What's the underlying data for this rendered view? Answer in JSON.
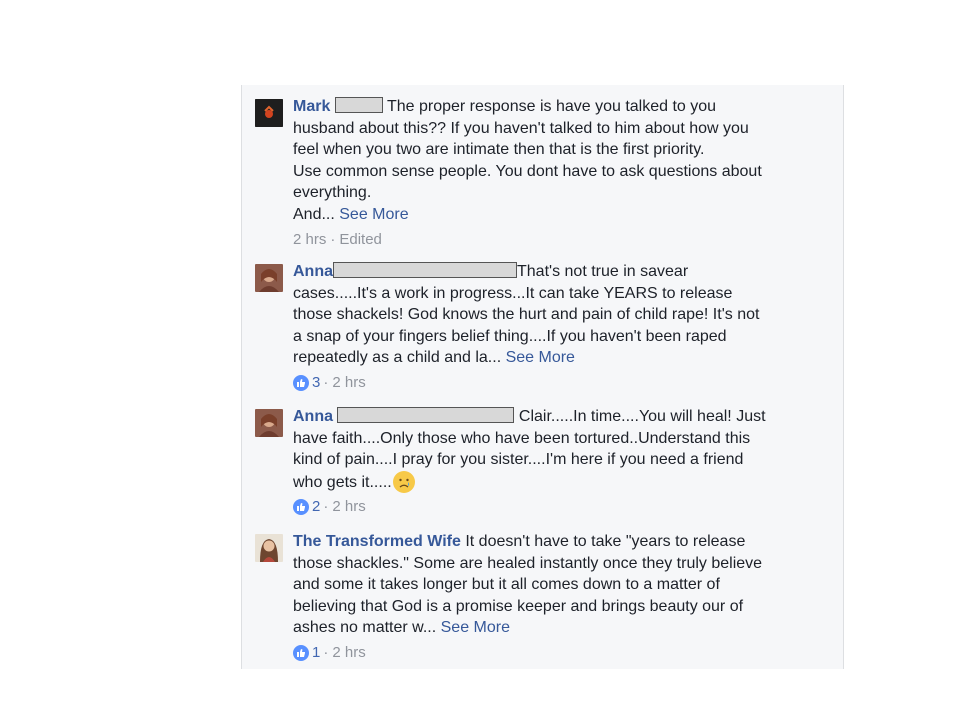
{
  "comments": [
    {
      "name": "Mark",
      "text_lines": [
        "The proper response is have you talked to you",
        "husband about this?? If you haven't talked to him about how you",
        "feel when you two are intimate then that is the first priority.",
        "Use common sense people. You dont have to ask questions about",
        "everything."
      ],
      "last_line": "And... ",
      "see_more": "See More",
      "time": "2 hrs",
      "edited": "Edited"
    },
    {
      "name": "Anna",
      "text_lines": [
        "That's not true in savear",
        "cases.....It's a work in progress...It can take YEARS to release",
        "those shackels! God knows the hurt and pain of child rape! It's not",
        "a snap of your fingers belief thing....If you haven't been raped"
      ],
      "last_line": "repeatedly as a child and la... ",
      "see_more": "See More",
      "likes": "3",
      "time": "2 hrs"
    },
    {
      "name": "Anna",
      "text_lines": [
        "Clair.....In time....You will heal! Just",
        "have faith....Only those who have been tortured..Understand this",
        "kind of pain....I pray for you sister....I'm here if you need a friend"
      ],
      "last_line": "who gets it.....",
      "emoji": "sad-face-emoji",
      "likes": "2",
      "time": "2 hrs"
    },
    {
      "name": "The Transformed Wife",
      "text_lines": [
        "It doesn't have to take \"years to release",
        "those shackles.\" Some are healed instantly once they truly believe",
        "and some it takes longer but it all comes down to a matter of",
        "believing that God is a promise keeper and brings beauty our of"
      ],
      "last_line": "ashes no matter w... ",
      "see_more": "See More",
      "likes": "1",
      "time": "2 hrs"
    }
  ],
  "separator": "·",
  "colors": {
    "name": "#365899",
    "text": "#1d2129",
    "meta": "#90949c",
    "like": "#5890ff",
    "panel": "#f6f7f9"
  }
}
